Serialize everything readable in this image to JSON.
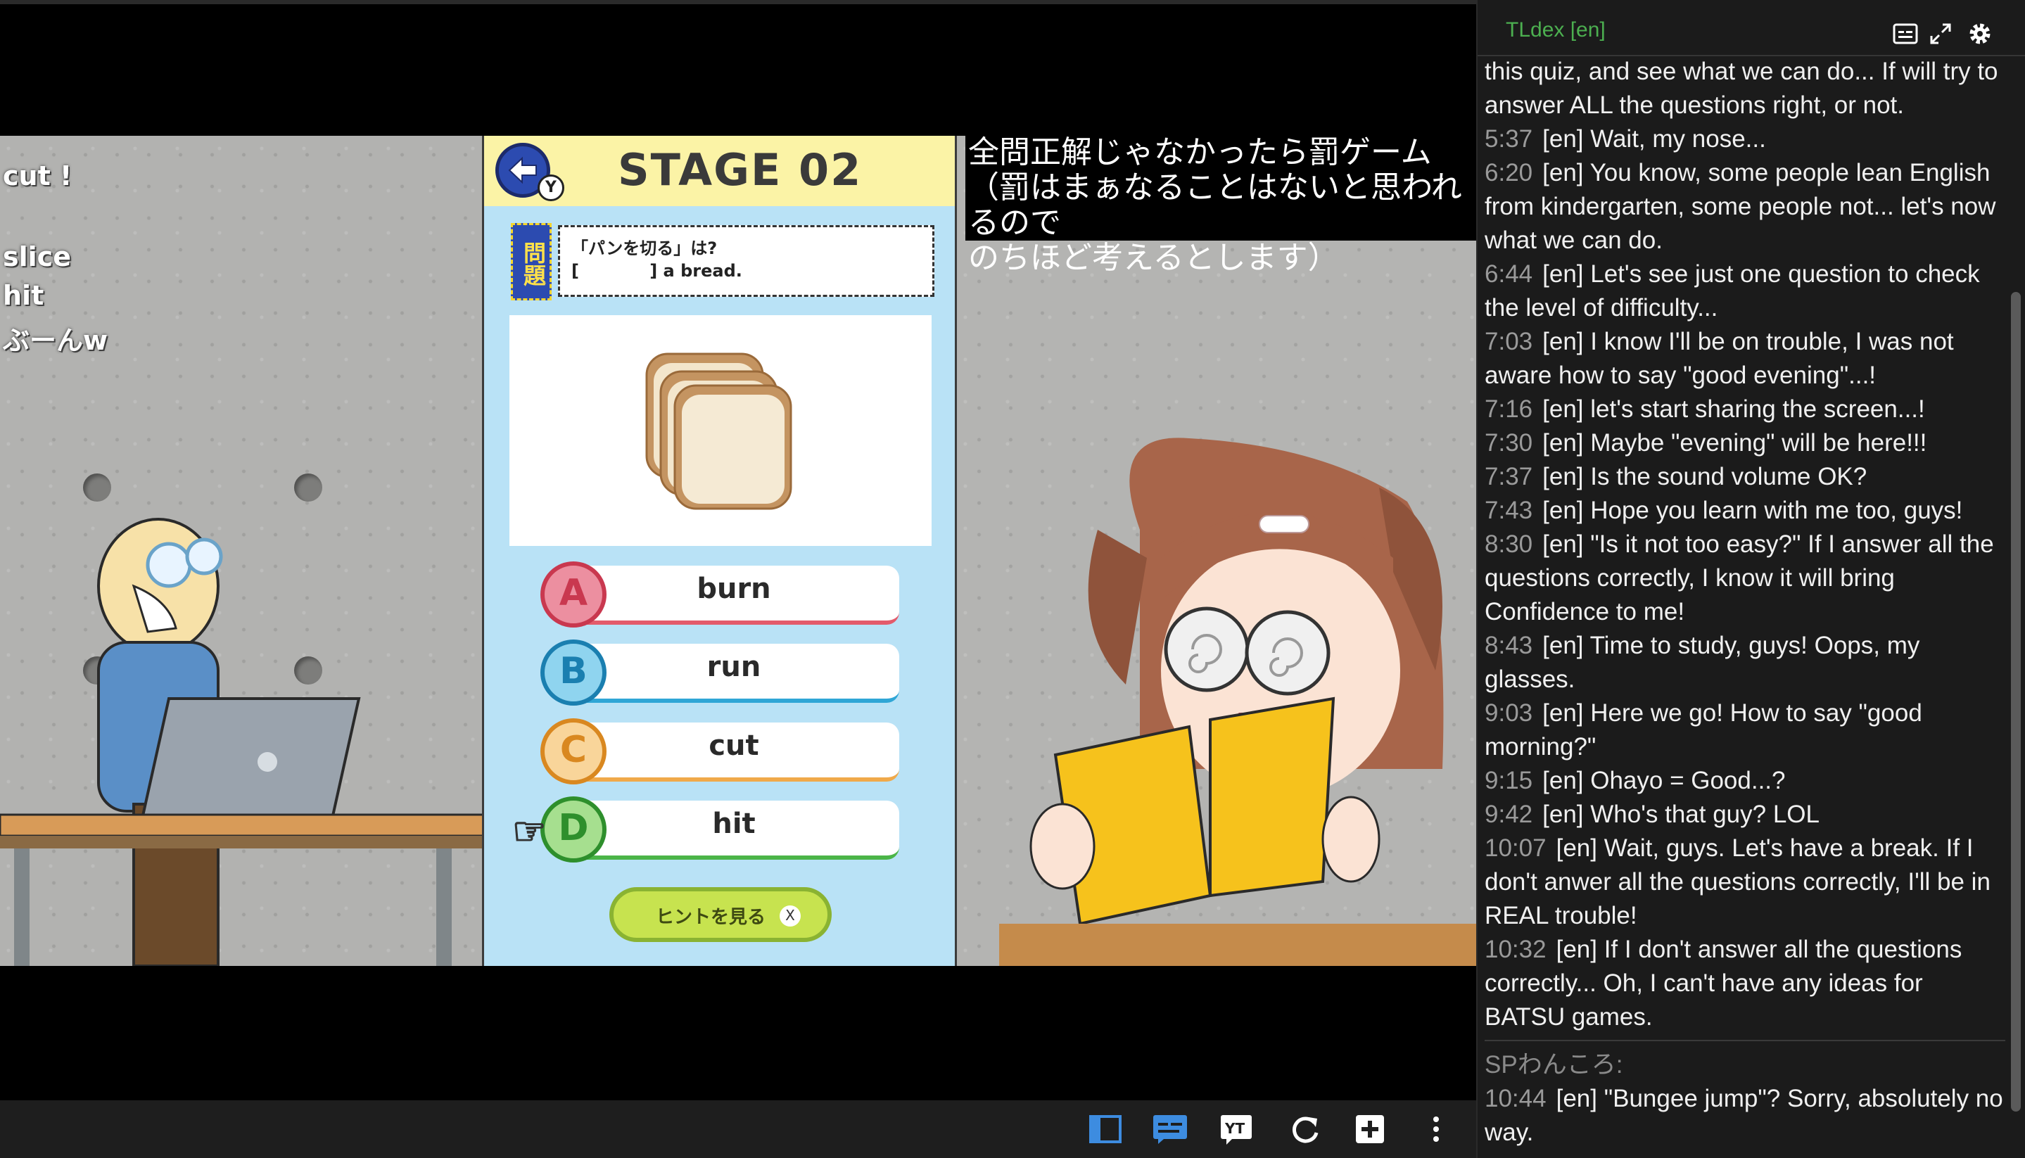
{
  "left_scene": {
    "words": [
      "cut !",
      "slice",
      "hit",
      "ぶーんw"
    ]
  },
  "quiz": {
    "stage_title": "STAGE 02",
    "back_badge": "Y",
    "question_tag": "問題",
    "question_line1": "「パンを切る」は?",
    "question_line2": "[            ] a bread.",
    "answers": [
      {
        "letter": "A",
        "text": "burn",
        "color": "#e35b6b"
      },
      {
        "letter": "B",
        "text": "run",
        "color": "#2fa6d6"
      },
      {
        "letter": "C",
        "text": "cut",
        "color": "#f0a94a"
      },
      {
        "letter": "D",
        "text": "hit",
        "color": "#4bb548"
      }
    ],
    "hint_label": "ヒントを見る",
    "hint_key": "X"
  },
  "caption": {
    "text": "全問正解じゃなかったら罰ゲーム\n（罰はまぁなることはないと思われるので\nのちほど考えるとします）"
  },
  "chat": {
    "title": "TLdex [en]",
    "intro": "this quiz, and see what we can do... If will try to answer ALL the questions right, or not.",
    "messages": [
      {
        "time": "5:37",
        "text": "[en] Wait, my nose..."
      },
      {
        "time": "6:20",
        "text": "[en] You know, some people lean English from kindergarten, some people not... let's now what we can do."
      },
      {
        "time": "6:44",
        "text": "[en] Let's see just one question to check the level of difficulty..."
      },
      {
        "time": "7:03",
        "text": "[en] I know I'll be on trouble, I was not aware how to say \"good evening\"...!"
      },
      {
        "time": "7:16",
        "text": "[en] let's start sharing the screen...!"
      },
      {
        "time": "7:30",
        "text": "[en] Maybe \"evening\" will be here!!!"
      },
      {
        "time": "7:37",
        "text": "[en] Is the sound volume OK?"
      },
      {
        "time": "7:43",
        "text": "[en] Hope you learn with me too, guys!"
      },
      {
        "time": "8:30",
        "text": "[en] \"Is it not too easy?\" If I answer all the questions correctly, I know it will bring Confidence to me!"
      },
      {
        "time": "8:43",
        "text": "[en] Time to study, guys! Oops, my glasses."
      },
      {
        "time": "9:03",
        "text": "[en] Here we go! How to say \"good morning?\""
      },
      {
        "time": "9:15",
        "text": "[en] Ohayo = Good...?"
      },
      {
        "time": "9:42",
        "text": "[en] Who's that guy? LOL"
      },
      {
        "time": "10:07",
        "text": "[en] Wait, guys. Let's have a break. If I don't anwer all the questions correctly, I'll be in REAL trouble!"
      },
      {
        "time": "10:32",
        "text": "[en] If I don't answer all the questions correctly... Oh, I can't have any ideas for BATSU games."
      }
    ],
    "sp_author": "SPわんころ:",
    "sp_message": {
      "time": "10:44",
      "text": "[en] \"Bungee jump\"? Sorry, absolutely no way."
    }
  },
  "player_bar": {
    "icons": [
      "layout-icon",
      "subtitles-icon",
      "youtube-icon",
      "refresh-icon",
      "add-icon",
      "more-icon"
    ]
  }
}
